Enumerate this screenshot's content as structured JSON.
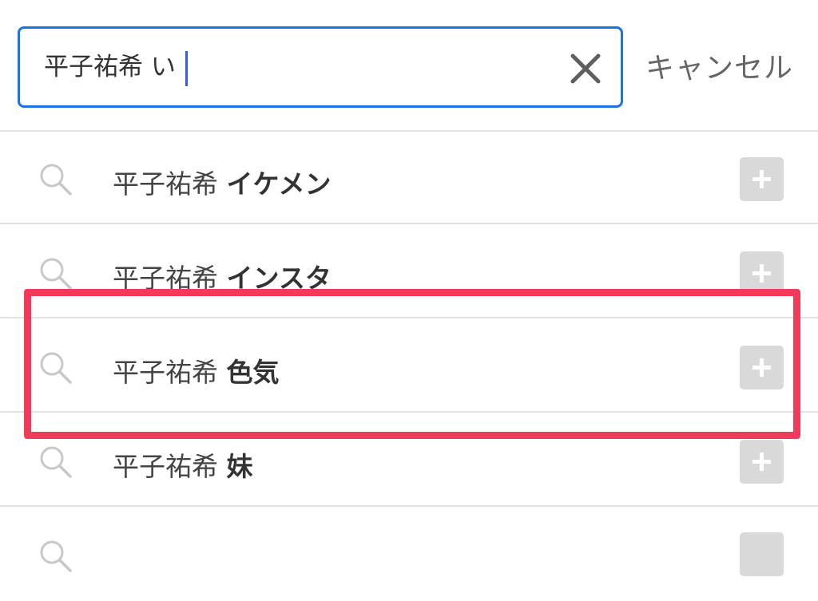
{
  "search": {
    "query": "平子祐希 い",
    "clear_icon": "close-icon",
    "cancel_label": "キャンセル"
  },
  "suggestions": [
    {
      "prefix": "平子祐希",
      "completion": "イケメン",
      "icon": "search-icon",
      "action_icon": "plus-icon"
    },
    {
      "prefix": "平子祐希",
      "completion": "インスタ",
      "icon": "search-icon",
      "action_icon": "plus-icon"
    },
    {
      "prefix": "平子祐希",
      "completion": "色気",
      "icon": "search-icon",
      "action_icon": "plus-icon"
    },
    {
      "prefix": "平子祐希",
      "completion": "妹",
      "icon": "search-icon",
      "action_icon": "plus-icon"
    }
  ],
  "colors": {
    "focus_border": "#1a73e8",
    "highlight_frame": "#f23a5a",
    "add_button": "#d9d9d9"
  }
}
